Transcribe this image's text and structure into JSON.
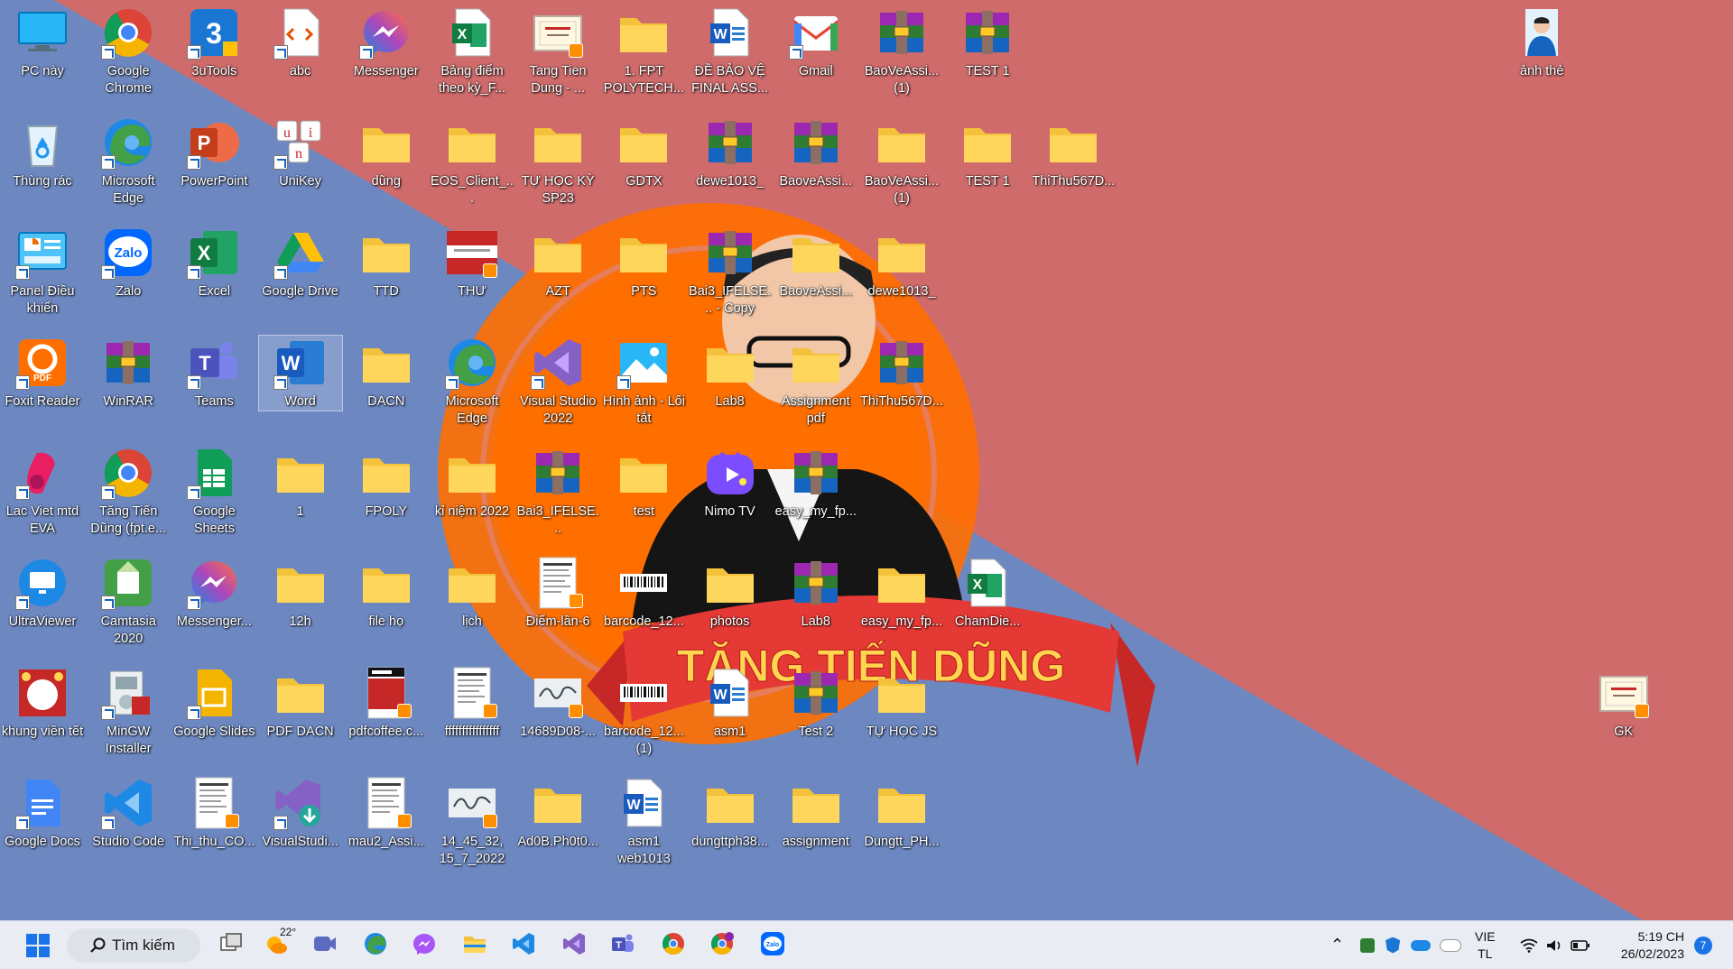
{
  "desktop": {
    "icons": [
      {
        "label": "PC này",
        "kind": "pc"
      },
      {
        "label": "Google Chrome",
        "kind": "chrome"
      },
      {
        "label": "3uTools",
        "kind": "tools3u"
      },
      {
        "label": "abc",
        "kind": "codefile"
      },
      {
        "label": "Messenger",
        "kind": "messenger"
      },
      {
        "label": "Bảng điểm theo kỳ_F...",
        "kind": "excelfile"
      },
      {
        "label": "Tang Tien Dung - ...",
        "kind": "certimg"
      },
      {
        "label": "1. FPT POLYTECH...",
        "kind": "folder"
      },
      {
        "label": "ĐỀ BẢO VỆ FINAL ASS...",
        "kind": "wordfile"
      },
      {
        "label": "Gmail",
        "kind": "gmail"
      },
      {
        "label": "BaoVeAssi... (1)",
        "kind": "rar"
      },
      {
        "label": "TEST 1",
        "kind": "rar"
      },
      {
        "label": "ảnh thẻ",
        "kind": "photo"
      },
      {
        "label": "Thùng rác",
        "kind": "recycle"
      },
      {
        "label": "Microsoft Edge",
        "kind": "edge"
      },
      {
        "label": "PowerPoint",
        "kind": "powerpoint"
      },
      {
        "label": "UniKey",
        "kind": "unikey"
      },
      {
        "label": "dũng",
        "kind": "folder"
      },
      {
        "label": "EOS_Client_...",
        "kind": "folder"
      },
      {
        "label": "TỰ HỌC KỲ SP23",
        "kind": "folder"
      },
      {
        "label": "GDTX",
        "kind": "folder"
      },
      {
        "label": "dewe1013_",
        "kind": "rar"
      },
      {
        "label": "BaoveAssi...",
        "kind": "rar"
      },
      {
        "label": "BaoVeAssi... (1)",
        "kind": "folder"
      },
      {
        "label": "TEST 1",
        "kind": "folder"
      },
      {
        "label": "ThiThu567D...",
        "kind": "folder"
      },
      {
        "label": "Panel Điều khiển",
        "kind": "controlpanel"
      },
      {
        "label": "Zalo",
        "kind": "zalo"
      },
      {
        "label": "Excel",
        "kind": "excel"
      },
      {
        "label": "Google Drive",
        "kind": "gdrive"
      },
      {
        "label": "TTD",
        "kind": "folder"
      },
      {
        "label": "THƯ",
        "kind": "redimg"
      },
      {
        "label": "AZT",
        "kind": "folder"
      },
      {
        "label": "PTS",
        "kind": "folder"
      },
      {
        "label": "Bai3_IFELSE... - Copy",
        "kind": "rar"
      },
      {
        "label": "BaoveAssi...",
        "kind": "folder"
      },
      {
        "label": "dewe1013_",
        "kind": "folder"
      },
      {
        "label": "Foxit Reader",
        "kind": "foxit"
      },
      {
        "label": "WinRAR",
        "kind": "rar"
      },
      {
        "label": "Teams",
        "kind": "teams"
      },
      {
        "label": "Word",
        "kind": "word"
      },
      {
        "label": "DACN",
        "kind": "folder"
      },
      {
        "label": "Microsoft Edge",
        "kind": "edge"
      },
      {
        "label": "Visual Studio 2022",
        "kind": "vs"
      },
      {
        "label": "Hình ảnh - Lối tắt",
        "kind": "images"
      },
      {
        "label": "Lab8",
        "kind": "folder"
      },
      {
        "label": "Assignment pdf",
        "kind": "folder"
      },
      {
        "label": "ThiThu567D...",
        "kind": "rar"
      },
      {
        "label": "Lac Viet mtd EVA",
        "kind": "lacviet"
      },
      {
        "label": "Tăng Tiến Dũng (fpt.e...",
        "kind": "chrome"
      },
      {
        "label": "Google Sheets",
        "kind": "gsheets"
      },
      {
        "label": "1",
        "kind": "folder"
      },
      {
        "label": "FPOLY",
        "kind": "folder"
      },
      {
        "label": "kỉ niệm 2022",
        "kind": "folder"
      },
      {
        "label": "Bai3_IFELSE...",
        "kind": "rar"
      },
      {
        "label": "test",
        "kind": "folder"
      },
      {
        "label": "Nimo TV",
        "kind": "nimo"
      },
      {
        "label": "easy_my_fp...",
        "kind": "rar"
      },
      {
        "label": "UltraViewer",
        "kind": "ultraviewer"
      },
      {
        "label": "Camtasia 2020",
        "kind": "camtasia"
      },
      {
        "label": "Messenger...",
        "kind": "messenger"
      },
      {
        "label": "12h",
        "kind": "folder"
      },
      {
        "label": "file họ",
        "kind": "folder"
      },
      {
        "label": "lịch",
        "kind": "folder"
      },
      {
        "label": "Điểm-lần-6",
        "kind": "docimg"
      },
      {
        "label": "barcode_12...",
        "kind": "barcode"
      },
      {
        "label": "photos",
        "kind": "folder"
      },
      {
        "label": "Lab8",
        "kind": "rar"
      },
      {
        "label": "easy_my_fp...",
        "kind": "folder"
      },
      {
        "label": "ChamDie...",
        "kind": "excelfile"
      },
      {
        "label": "khung viền tết",
        "kind": "frameimg"
      },
      {
        "label": "MinGW Installer",
        "kind": "mingw"
      },
      {
        "label": "Google Slides",
        "kind": "gslides"
      },
      {
        "label": "PDF DACN",
        "kind": "folder"
      },
      {
        "label": "pdfcoffee.c...",
        "kind": "pdfimg"
      },
      {
        "label": "ffffffffffffffff",
        "kind": "docimg"
      },
      {
        "label": "14689D08-...",
        "kind": "sigimg"
      },
      {
        "label": "barcode_12... (1)",
        "kind": "barcode"
      },
      {
        "label": "asm1",
        "kind": "wordfile"
      },
      {
        "label": "Test 2",
        "kind": "rar"
      },
      {
        "label": "TỰ HỌC JS",
        "kind": "folder"
      },
      {
        "label": "GK",
        "kind": "certimg"
      },
      {
        "label": "Google Docs",
        "kind": "gdocs"
      },
      {
        "label": "Studio Code",
        "kind": "vscode"
      },
      {
        "label": "Thi_thu_CO...",
        "kind": "docimg"
      },
      {
        "label": "VisualStudi...",
        "kind": "vsinstaller"
      },
      {
        "label": "mau2_Assi...",
        "kind": "docimg"
      },
      {
        "label": "14_45_32, 15_7_2022",
        "kind": "sigimg"
      },
      {
        "label": "Ad0B.Ph0t0...",
        "kind": "folder"
      },
      {
        "label": "asm1 web1013",
        "kind": "wordfile"
      },
      {
        "label": "dungttph38...",
        "kind": "folder"
      },
      {
        "label": "assignment",
        "kind": "folder"
      },
      {
        "label": "Dungtt_PH...",
        "kind": "folder"
      }
    ],
    "banner_text": "TĂNG TIẾN DŨNG"
  },
  "taskbar": {
    "search_label": "Tìm kiếm",
    "weather_temp": "22°",
    "apps": [
      "task-view",
      "weather",
      "meet",
      "edge",
      "messenger",
      "file-explorer",
      "vscode",
      "visual-studio",
      "teams",
      "chrome",
      "chrome-profile",
      "zalo"
    ],
    "lang_top": "VIE",
    "lang_bottom": "TL",
    "time": "5:19 CH",
    "date": "26/02/2023",
    "notification_count": "7"
  },
  "colors": {
    "wallpaper_blue": "#6d88c1",
    "wallpaper_red": "#cf6b6b",
    "orange": "#ff6f00",
    "banner_red": "#e53935",
    "banner_text": "#ffd54f"
  }
}
